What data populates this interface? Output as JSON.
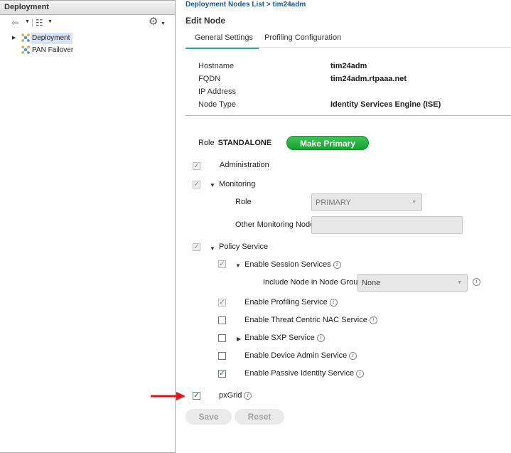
{
  "left_panel": {
    "title": "Deployment",
    "tree": [
      {
        "label": "Deployment",
        "selected": true
      },
      {
        "label": "PAN Failover",
        "selected": false
      }
    ]
  },
  "breadcrumb": "Deployment Nodes List > tim24adm",
  "page_title": "Edit Node",
  "tabs": [
    {
      "label": "General Settings",
      "active": true
    },
    {
      "label": "Profiling Configuration",
      "active": false
    }
  ],
  "node_info": {
    "hostname_label": "Hostname",
    "hostname": "tim24adm",
    "fqdn_label": "FQDN",
    "fqdn": "tim24adm.rtpaaa.net",
    "ip_label": "IP Address",
    "ip": "",
    "type_label": "Node Type",
    "type": "Identity Services Engine (ISE)"
  },
  "role": {
    "label": "Role",
    "value": "STANDALONE",
    "make_primary": "Make Primary"
  },
  "personas": {
    "administration": "Administration",
    "monitoring": "Monitoring",
    "monitoring_role_label": "Role",
    "monitoring_role_value": "PRIMARY",
    "other_monitoring_label": "Other Monitoring Node",
    "other_monitoring_value": "",
    "policy_service": "Policy Service",
    "session_services": "Enable Session Services",
    "node_group_label": "Include Node in Node Group",
    "node_group_value": "None",
    "profiling": "Enable Profiling Service",
    "threat_nac": "Enable Threat Centric NAC Service",
    "sxp": "Enable SXP Service",
    "device_admin": "Enable Device Admin Service",
    "passive_identity": "Enable Passive Identity Service",
    "pxgrid": "pxGrid"
  },
  "buttons": {
    "save": "Save",
    "reset": "Reset"
  },
  "colors": {
    "link": "#1b5a91",
    "tab_accent": "#2aa3a3",
    "primary_green": "#22b33c",
    "annotation_arrow": "#e3141b"
  }
}
